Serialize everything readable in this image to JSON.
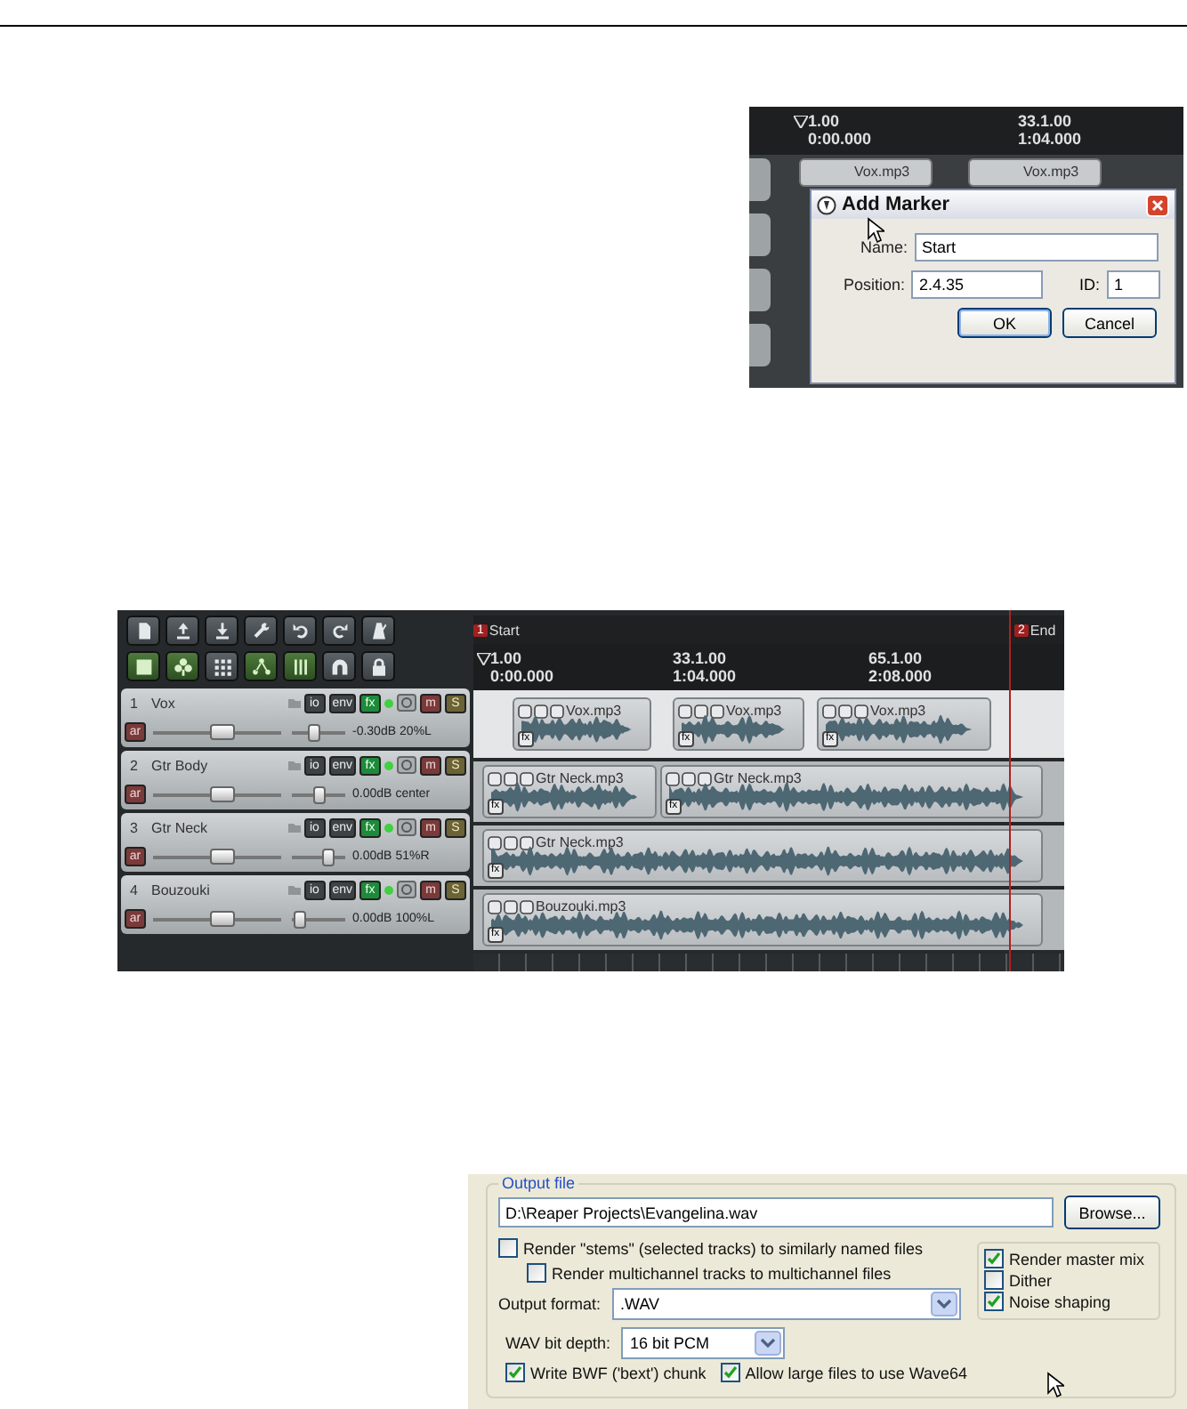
{
  "marker_shot": {
    "timeline": [
      {
        "bar": "1.00",
        "time": "0:00.000"
      },
      {
        "bar": "33.1.00",
        "time": "1:04.000"
      }
    ],
    "items": [
      {
        "name": "Vox.mp3"
      },
      {
        "name": "Vox.mp3"
      }
    ],
    "dialog": {
      "title": "Add Marker",
      "name_label": "Name:",
      "name_value": "Start",
      "position_label": "Position:",
      "position_value": "2.4.35",
      "id_label": "ID:",
      "id_value": "1",
      "buttons": [
        {
          "label": "OK",
          "default": true
        },
        {
          "label": "Cancel",
          "default": false
        }
      ]
    }
  },
  "project_shot": {
    "toolbar": [
      {
        "on": false
      },
      {
        "on": false
      },
      {
        "on": false
      },
      {
        "on": false
      },
      {
        "on": false
      },
      {
        "on": false
      },
      {
        "on": false
      },
      {
        "on": true
      },
      {
        "on": true
      },
      {
        "on": false
      },
      {
        "on": true
      },
      {
        "on": true
      },
      {
        "on": false
      },
      {
        "on": false
      }
    ],
    "tracks": [
      {
        "number": "1",
        "name": "Vox",
        "io": "io",
        "env": "env",
        "fx": "fx",
        "fx_on": true,
        "mute": "m",
        "solo": "S",
        "arm": "ar",
        "volume_slider": {
          "level": 0.55
        },
        "pan_slider": {
          "level": 0.4
        },
        "volume": "-0.30dB",
        "pan": "20%L"
      },
      {
        "number": "2",
        "name": "Gtr Body",
        "io": "io",
        "env": "env",
        "fx": "fx",
        "fx_on": true,
        "mute": "m",
        "solo": "S",
        "arm": "ar",
        "volume_slider": {
          "level": 0.55
        },
        "pan_slider": {
          "level": 0.5
        },
        "volume": "0.00dB",
        "pan": "center"
      },
      {
        "number": "3",
        "name": "Gtr Neck",
        "io": "io",
        "env": "env",
        "fx": "fx",
        "fx_on": true,
        "mute": "m",
        "solo": "S",
        "arm": "ar",
        "volume_slider": {
          "level": 0.55
        },
        "pan_slider": {
          "level": 0.75
        },
        "volume": "0.00dB",
        "pan": "51%R"
      },
      {
        "number": "4",
        "name": "Bouzouki",
        "io": "io",
        "env": "env",
        "fx": "fx",
        "fx_on": true,
        "mute": "m",
        "solo": "S",
        "arm": "ar",
        "volume_slider": {
          "level": 0.55
        },
        "pan_slider": {
          "level": 0.05
        },
        "volume": "0.00dB",
        "pan": "100%L"
      }
    ],
    "markers": [
      {
        "number": "1",
        "name": "Start"
      },
      {
        "number": "2",
        "name": "End"
      }
    ],
    "timeline": [
      {
        "bar": "1.00",
        "time": "0:00.000"
      },
      {
        "bar": "33.1.00",
        "time": "1:04.000"
      },
      {
        "bar": "65.1.00",
        "time": "2:08.000"
      }
    ],
    "lanes": [
      {
        "items": [
          {
            "name": "Vox.mp3",
            "fx": "fx"
          },
          {
            "name": "Vox.mp3",
            "fx": "fx"
          },
          {
            "name": "Vox.mp3",
            "fx": "fx"
          }
        ]
      },
      {
        "items": [
          {
            "name": "Gtr Neck.mp3",
            "fx": "fx"
          },
          {
            "name": "Gtr Neck.mp3",
            "fx": "fx"
          }
        ]
      },
      {
        "items": [
          {
            "name": "Gtr Neck.mp3",
            "fx": "fx"
          }
        ]
      },
      {
        "items": [
          {
            "name": "Bouzouki.mp3",
            "fx": "fx"
          }
        ]
      }
    ]
  },
  "render_shot": {
    "group_title": "Output file",
    "path": "D:\\Reaper Projects\\Evangelina.wav",
    "browse": "Browse...",
    "options": [
      {
        "label": "Render \"stems\" (selected tracks) to similarly named files",
        "checked": false
      },
      {
        "label": "Render multichannel tracks to multichannel files",
        "checked": false
      }
    ],
    "format_label": "Output format:",
    "format_value": ".WAV",
    "mix_options": [
      {
        "label": "Render master mix",
        "checked": true
      },
      {
        "label": "Dither",
        "checked": false
      },
      {
        "label": "Noise shaping",
        "checked": true
      }
    ],
    "bit_depth_label": "WAV bit depth:",
    "bit_depth_value": "16 bit PCM",
    "wav_options": [
      {
        "label": "Write BWF ('bext') chunk",
        "checked": true
      },
      {
        "label": "Allow large files to use Wave64",
        "checked": true
      }
    ]
  }
}
